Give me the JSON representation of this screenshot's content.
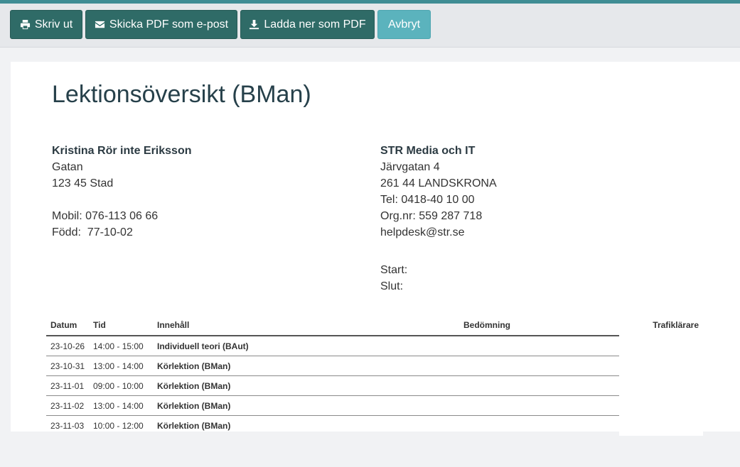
{
  "toolbar": {
    "print_label": "Skriv ut",
    "email_label": "Skicka PDF som e-post",
    "download_label": "Ladda ner som PDF",
    "cancel_label": "Avbryt"
  },
  "document": {
    "title": "Lektionsöversikt (BMan)",
    "student": {
      "name": "Kristina Rör inte Eriksson",
      "street": "Gatan",
      "city": "123 45 Stad",
      "mobile": "Mobil: 076-113 06 66",
      "born": "Född:  77-10-02"
    },
    "school": {
      "name": "STR Media och IT",
      "street": "Järvgatan 4",
      "city": "261 44 LANDSKRONA",
      "tel": "Tel: 0418-40 10 00",
      "orgnr": "Org.nr: 559 287 718",
      "email": "helpdesk@str.se",
      "start": "Start:",
      "end": "Slut:"
    },
    "table": {
      "headers": {
        "date": "Datum",
        "time": "Tid",
        "content": "Innehåll",
        "assessment": "Bedömning",
        "instructor": "Trafiklärare"
      },
      "rows": [
        {
          "date": "23-10-26",
          "time": "14:00 - 15:00",
          "content": "Individuell teori (BAut)"
        },
        {
          "date": "23-10-31",
          "time": "13:00 - 14:00",
          "content": "Körlektion (BMan)"
        },
        {
          "date": "23-11-01",
          "time": "09:00 - 10:00",
          "content": "Körlektion (BMan)"
        },
        {
          "date": "23-11-02",
          "time": "13:00 - 14:00",
          "content": "Körlektion (BMan)"
        },
        {
          "date": "23-11-03",
          "time": "10:00 - 12:00",
          "content": "Körlektion (BMan)"
        }
      ]
    }
  },
  "icons": {
    "print": "print-icon",
    "email": "envelope-icon",
    "download": "download-icon"
  },
  "colors": {
    "accent_dark": "#2f6b67",
    "accent_light": "#5bb3bd",
    "top_line": "#3f8d94"
  }
}
